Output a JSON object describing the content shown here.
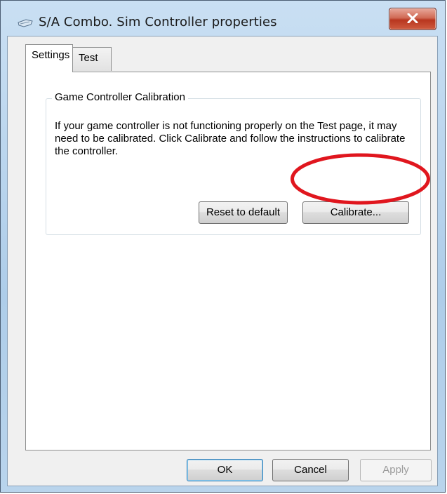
{
  "window": {
    "title": "S/A Combo. Sim Controller properties",
    "title_icon": "game-controller-icon",
    "close_icon": "close-icon"
  },
  "tabs": [
    {
      "label": "Settings",
      "active": true
    },
    {
      "label": "Test",
      "active": false
    }
  ],
  "calibration": {
    "group_title": "Game Controller Calibration",
    "description": "If your game controller is not functioning properly on the Test page, it may need to be calibrated.  Click Calibrate and follow the instructions to calibrate the controller.",
    "reset_label": "Reset to default",
    "calibrate_label": "Calibrate..."
  },
  "footer": {
    "ok_label": "OK",
    "cancel_label": "Cancel",
    "apply_label": "Apply"
  },
  "colors": {
    "annotation_circle": "#e0161e",
    "close_button": "#c8452b"
  }
}
